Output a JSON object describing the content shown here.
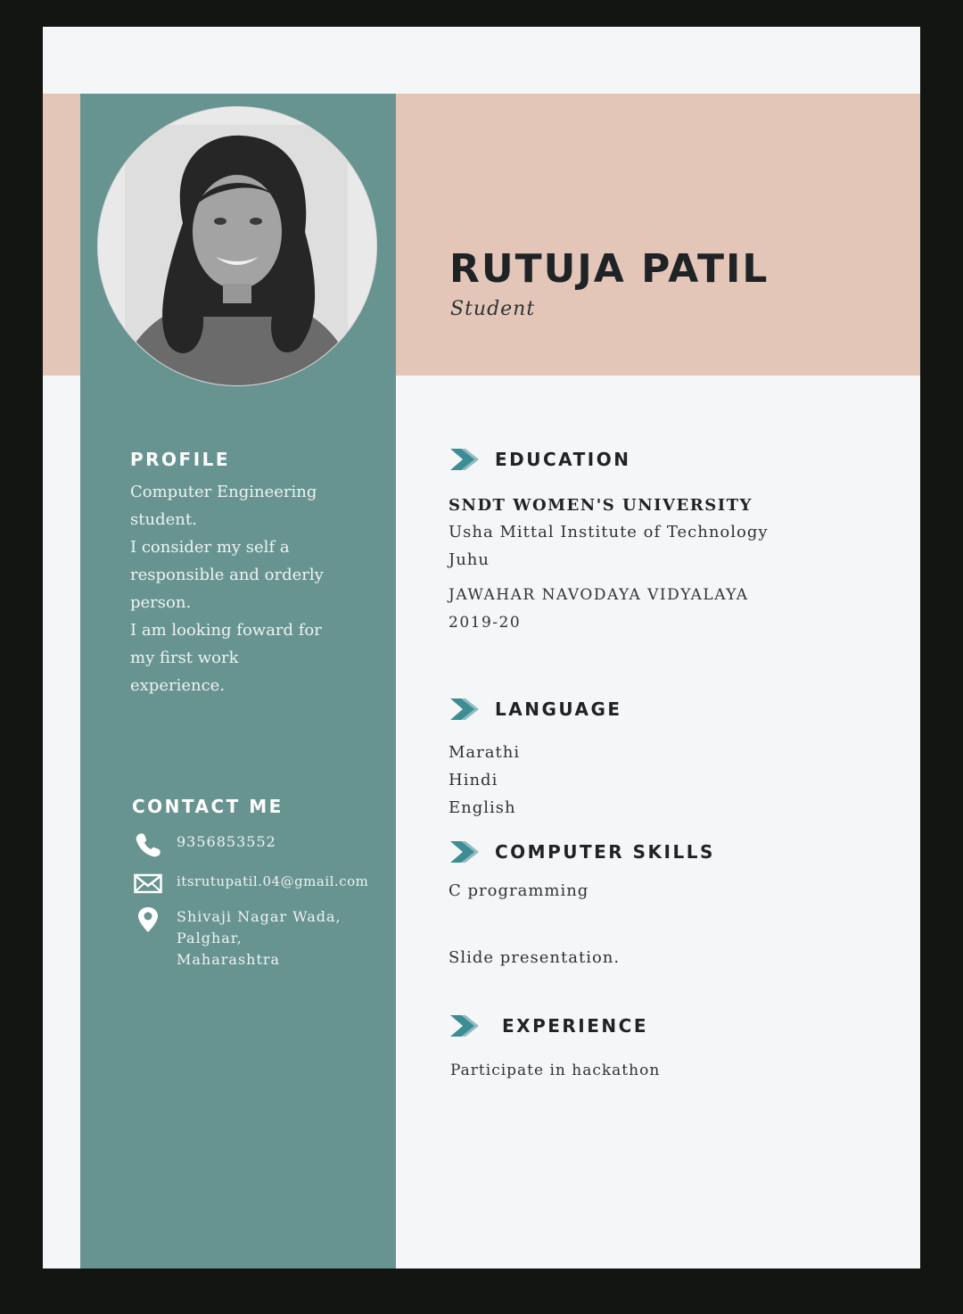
{
  "header": {
    "name": "RUTUJA PATIL",
    "role": "Student"
  },
  "sidebar": {
    "profile_heading": "PROFILE",
    "profile_lines": [
      "Computer Engineering",
      "student.",
      "I consider my self a",
      "responsible and orderly",
      "person.",
      "I am looking foward for",
      "my first work",
      "experience."
    ],
    "contact_heading": "CONTACT ME",
    "phone": "9356853552",
    "email": "itsrutupatil.04@gmail.com",
    "address_lines": [
      "Shivaji Nagar Wada,",
      "Palghar,",
      "Maharashtra"
    ]
  },
  "education": {
    "heading": "EDUCATION",
    "university": "SNDT WOMEN'S UNIVERSITY",
    "institute": "Usha Mittal Institute of Technology",
    "location": "Juhu",
    "school": "JAWAHAR NAVODAYA VIDYALAYA",
    "year": "2019-20"
  },
  "language": {
    "heading": "LANGUAGE",
    "items": [
      "Marathi",
      "Hindi",
      "English"
    ]
  },
  "skills": {
    "heading": "COMPUTER SKILLS",
    "items": [
      "C programming",
      "Slide presentation."
    ]
  },
  "experience": {
    "heading": "EXPERIENCE",
    "items": [
      "Participate in hackathon"
    ]
  },
  "colors": {
    "sidebar": "#679491",
    "header_band": "#e4c6b9",
    "accent_arrow": "#3d8d94"
  },
  "icons": {
    "section_marker": "chevron-arrow-icon",
    "phone": "phone-icon",
    "email": "mail-icon",
    "address": "location-pin-icon"
  }
}
